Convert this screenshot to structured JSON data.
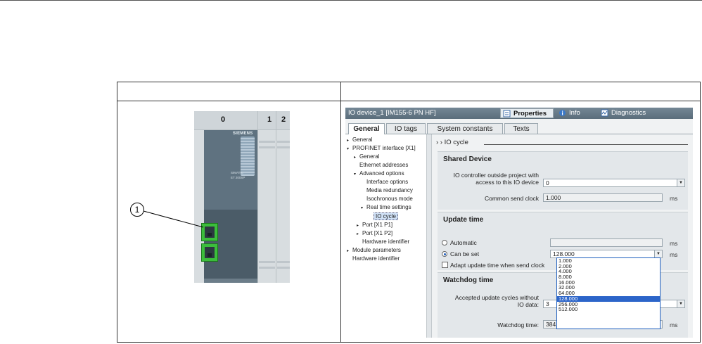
{
  "hardware": {
    "slots": [
      "0",
      "1",
      "2"
    ],
    "brand": "SIEMENS",
    "model_line1": "SIMATIC",
    "model_line2": "ET 200SP",
    "callout": "1"
  },
  "window": {
    "title": "IO device_1 [IM155-6 PN HF]",
    "tabs": [
      "Properties",
      "Info",
      "Diagnostics"
    ],
    "property_tabs": [
      "General",
      "IO tags",
      "System constants",
      "Texts"
    ]
  },
  "tree": {
    "items": [
      {
        "label": "General",
        "arrow": "▸"
      },
      {
        "label": "PROFINET interface [X1]",
        "arrow": "▾"
      },
      {
        "label": "General",
        "arrow": "▸"
      },
      {
        "label": "Ethernet addresses",
        "arrow": ""
      },
      {
        "label": "Advanced options",
        "arrow": "▾"
      },
      {
        "label": "Interface options",
        "arrow": ""
      },
      {
        "label": "Media redundancy",
        "arrow": ""
      },
      {
        "label": "Isochronous mode",
        "arrow": ""
      },
      {
        "label": "Real time settings",
        "arrow": "▾"
      },
      {
        "label": "IO cycle",
        "arrow": ""
      },
      {
        "label": "Port [X1 P1]",
        "arrow": "▸"
      },
      {
        "label": "Port [X1 P2]",
        "arrow": "▸"
      },
      {
        "label": "Hardware identifier",
        "arrow": ""
      },
      {
        "label": "Module parameters",
        "arrow": "▸"
      },
      {
        "label": "Hardware identifier",
        "arrow": ""
      }
    ]
  },
  "content": {
    "breadcrumb": "› ›  IO cycle",
    "shared_device": {
      "heading": "Shared Device",
      "controller_label": "IO controller outside project with access to this IO device",
      "controller_value": "0",
      "send_clock_label": "Common send clock",
      "send_clock_value": "1.000",
      "unit": "ms"
    },
    "update_time": {
      "heading": "Update time",
      "automatic_label": "Automatic",
      "can_be_set_label": "Can be set",
      "selected_value": "128.000",
      "adapt_label": "Adapt update time when send clock",
      "unit": "ms"
    },
    "watchdog": {
      "heading": "Watchdog time",
      "accepted_label_line1": "Accepted update cycles without",
      "accepted_label_line2": "IO data:",
      "accepted_value": "3",
      "watchdog_label": "Watchdog time:",
      "watchdog_value": "384.",
      "unit": "ms"
    },
    "dropdown_options": [
      "1.000",
      "2.000",
      "4.000",
      "8.000",
      "16.000",
      "32.000",
      "64.000",
      "128.000",
      "256.000",
      "512.000"
    ],
    "dropdown_highlight": "128.000"
  }
}
